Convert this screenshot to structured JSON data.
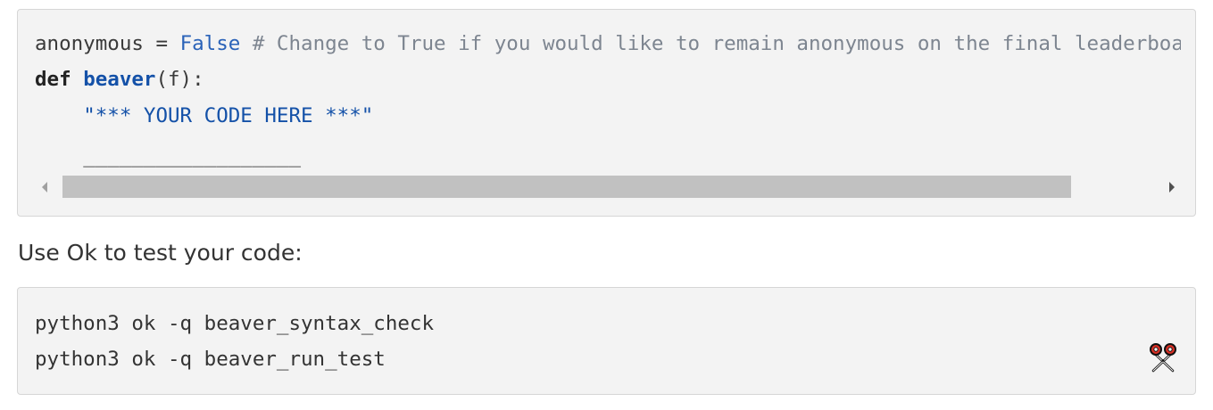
{
  "code_block_1": {
    "line1": {
      "var": "anonymous = ",
      "false_kw": "False",
      "comment": " # Change to True if you would like to remain anonymous on the final leaderboard."
    },
    "line2": {
      "def_kw": "def",
      "space": " ",
      "fn_name": "beaver",
      "params": "(f):"
    },
    "line3": {
      "indent": "    ",
      "string": "\"*** YOUR CODE HERE ***\""
    },
    "line4": {
      "indent": "    ",
      "blank": "__________________"
    }
  },
  "instruction_text": "Use Ok to test your code:",
  "code_block_2": {
    "commands": [
      "python3 ok -q beaver_syntax_check",
      "python3 ok -q beaver_run_test"
    ]
  },
  "icons": {
    "copy": "scissors-icon",
    "scroll_left": "scroll-left-arrow-icon",
    "scroll_right": "scroll-right-arrow-icon"
  },
  "colors": {
    "code_bg": "#f3f3f3",
    "keyword_blue": "#2a62b8",
    "comment_gray": "#7d8590",
    "scissors_red": "#d93025"
  }
}
